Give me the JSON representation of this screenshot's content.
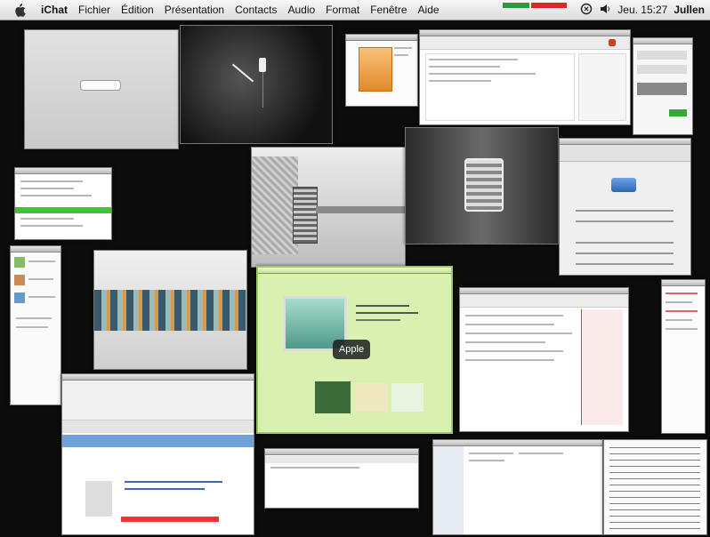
{
  "menubar": {
    "items": [
      "iChat",
      "Fichier",
      "Édition",
      "Présentation",
      "Contacts",
      "Audio",
      "Format",
      "Fenêtre",
      "Aide"
    ],
    "clock": "Jeu. 15:27",
    "user": "Jullen"
  },
  "expose": {
    "hovered_label": "Apple"
  },
  "colors": {
    "desktop": "#0c0c0c",
    "green_page": "#d9f0b0",
    "status_green": "#2a9a3a",
    "status_red": "#d8282b"
  }
}
